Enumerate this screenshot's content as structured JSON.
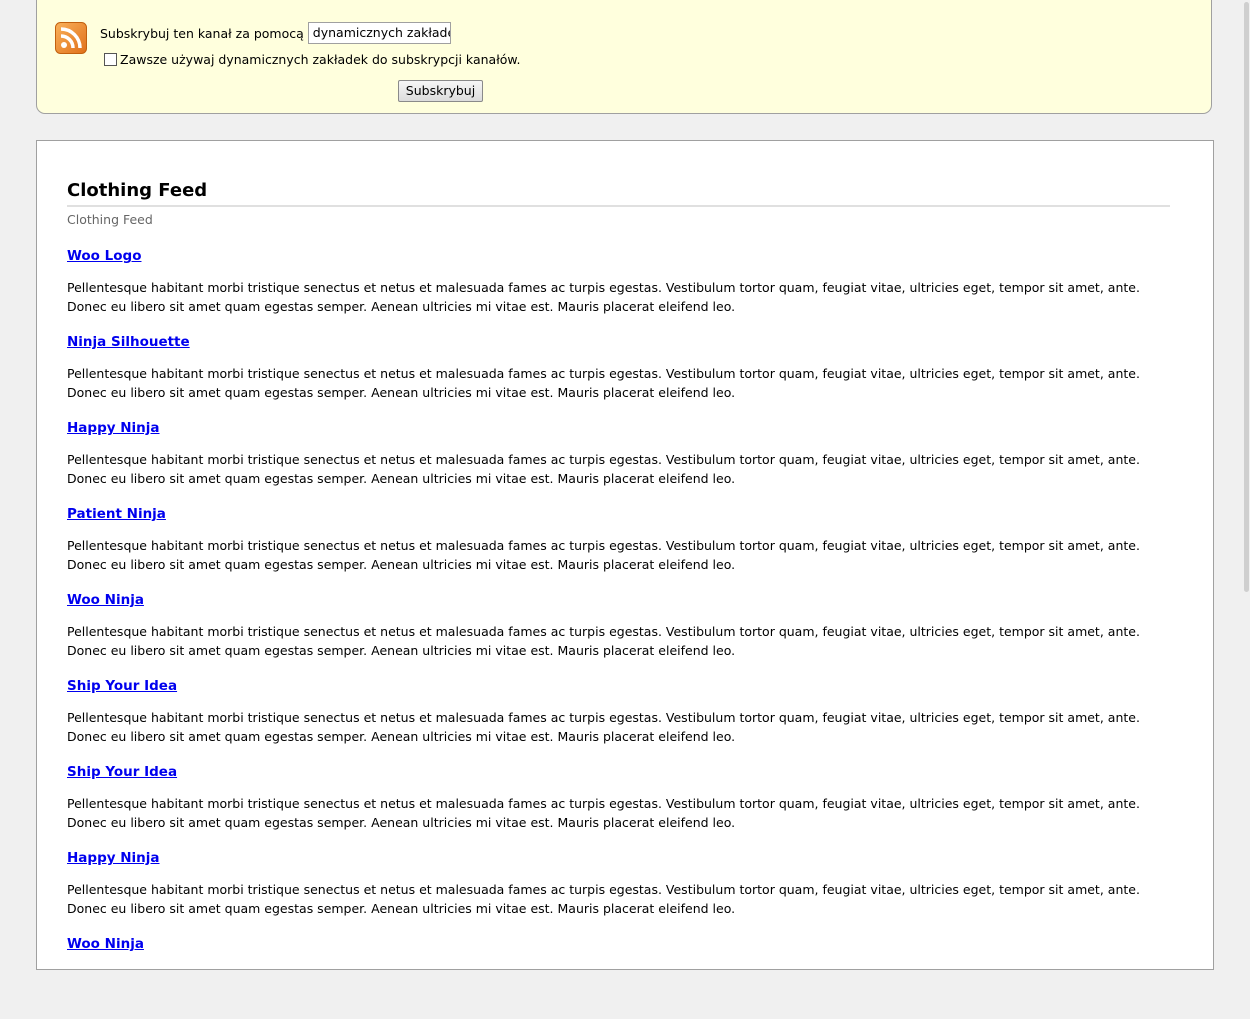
{
  "subscribe": {
    "label": "Subskrybuj ten kanał za pomocą",
    "reader_value": "dynamicznych zakładek",
    "always_label": "Zawsze używaj dynamicznych zakładek do subskrypcji kanałów.",
    "always_checked": false,
    "button_label": "Subskrybuj"
  },
  "feed": {
    "title": "Clothing Feed",
    "subtitle": "Clothing Feed",
    "entries": [
      {
        "title": "Woo Logo",
        "body": "Pellentesque habitant morbi tristique senectus et netus et malesuada fames ac turpis egestas. Vestibulum tortor quam, feugiat vitae, ultricies eget, tempor sit amet, ante. Donec eu libero sit amet quam egestas semper. Aenean ultricies mi vitae est. Mauris placerat eleifend leo."
      },
      {
        "title": "Ninja Silhouette",
        "body": "Pellentesque habitant morbi tristique senectus et netus et malesuada fames ac turpis egestas. Vestibulum tortor quam, feugiat vitae, ultricies eget, tempor sit amet, ante. Donec eu libero sit amet quam egestas semper. Aenean ultricies mi vitae est. Mauris placerat eleifend leo."
      },
      {
        "title": "Happy Ninja",
        "body": "Pellentesque habitant morbi tristique senectus et netus et malesuada fames ac turpis egestas. Vestibulum tortor quam, feugiat vitae, ultricies eget, tempor sit amet, ante. Donec eu libero sit amet quam egestas semper. Aenean ultricies mi vitae est. Mauris placerat eleifend leo."
      },
      {
        "title": "Patient Ninja",
        "body": "Pellentesque habitant morbi tristique senectus et netus et malesuada fames ac turpis egestas. Vestibulum tortor quam, feugiat vitae, ultricies eget, tempor sit amet, ante. Donec eu libero sit amet quam egestas semper. Aenean ultricies mi vitae est. Mauris placerat eleifend leo."
      },
      {
        "title": "Woo Ninja",
        "body": "Pellentesque habitant morbi tristique senectus et netus et malesuada fames ac turpis egestas. Vestibulum tortor quam, feugiat vitae, ultricies eget, tempor sit amet, ante. Donec eu libero sit amet quam egestas semper. Aenean ultricies mi vitae est. Mauris placerat eleifend leo."
      },
      {
        "title": "Ship Your Idea",
        "body": "Pellentesque habitant morbi tristique senectus et netus et malesuada fames ac turpis egestas. Vestibulum tortor quam, feugiat vitae, ultricies eget, tempor sit amet, ante. Donec eu libero sit amet quam egestas semper. Aenean ultricies mi vitae est. Mauris placerat eleifend leo."
      },
      {
        "title": "Ship Your Idea",
        "body": "Pellentesque habitant morbi tristique senectus et netus et malesuada fames ac turpis egestas. Vestibulum tortor quam, feugiat vitae, ultricies eget, tempor sit amet, ante. Donec eu libero sit amet quam egestas semper. Aenean ultricies mi vitae est. Mauris placerat eleifend leo."
      },
      {
        "title": "Happy Ninja",
        "body": "Pellentesque habitant morbi tristique senectus et netus et malesuada fames ac turpis egestas. Vestibulum tortor quam, feugiat vitae, ultricies eget, tempor sit amet, ante. Donec eu libero sit amet quam egestas semper. Aenean ultricies mi vitae est. Mauris placerat eleifend leo."
      },
      {
        "title": "Woo Ninja",
        "body": ""
      }
    ]
  },
  "icons": {
    "feed": "rss-feed-icon",
    "checkbox": "checkbox-icon"
  },
  "colors": {
    "subscribe_bg": "#ffffdd",
    "feed_icon": "#f48d20",
    "link": "#0000ee"
  }
}
